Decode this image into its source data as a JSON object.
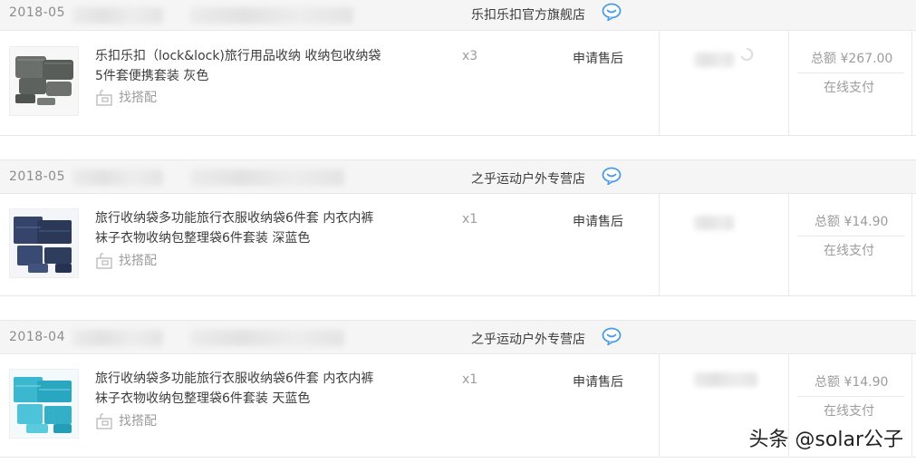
{
  "orders": [
    {
      "date": "2018-05",
      "shop_name": "乐扣乐扣官方旗舰店",
      "product_title": "乐扣乐扣（lock&lock)旅行用品收纳 收纳包收纳袋5件套便携套装 灰色",
      "match_label": "找搭配",
      "quantity": "x3",
      "after_sale_label": "申请售后",
      "total_label": "总额 ¥267.00",
      "pay_method": "在线支付"
    },
    {
      "date": "2018-05",
      "shop_name": "之乎运动户外专营店",
      "product_title": "旅行收纳袋多功能旅行衣服收纳袋6件套 内衣内裤袜子衣物收纳包整理袋6件套装 深蓝色",
      "match_label": "找搭配",
      "quantity": "x1",
      "after_sale_label": "申请售后",
      "total_label": "总额 ¥14.90",
      "pay_method": "在线支付"
    },
    {
      "date": "2018-04",
      "shop_name": "之乎运动户外专营店",
      "product_title": "旅行收纳袋多功能旅行衣服收纳袋6件套 内衣内裤袜子衣物收纳包整理袋6件套装 天蓝色",
      "match_label": "找搭配",
      "quantity": "x1",
      "after_sale_label": "申请售后",
      "total_label": "总额 ¥14.90",
      "pay_method": "在线支付"
    }
  ],
  "colors": {
    "header_bg": "#f5f5f5",
    "chat_icon": "#4a9be8",
    "product_gray": "#5d625f",
    "product_navy": "#2f3d5c",
    "product_skyblue": "#3bb8cf"
  },
  "icons": {
    "chat": "chat-bubble-icon",
    "match": "match-bag-icon"
  },
  "watermark": "头条 @solar公子"
}
